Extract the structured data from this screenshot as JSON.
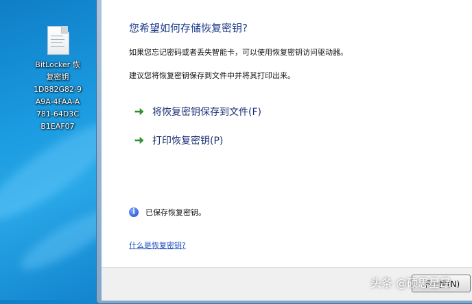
{
  "desktop": {
    "file_label_lines": [
      "BitLocker 恢",
      "复密钥",
      "1D882G82-9",
      "A9A-4FAA-A",
      "781-64D3C",
      "B1EAF07"
    ]
  },
  "dialog": {
    "title": "您希望如何存储恢复密钥?",
    "paragraph1": "如果您忘记密码或者丢失智能卡，可以使用恢复密钥访问驱动器。",
    "paragraph2": "建议您将恢复密钥保存到文件中并将其打印出来。",
    "commands": [
      {
        "label": "将恢复密钥保存到文件(F)",
        "icon": "green-arrow-icon"
      },
      {
        "label": "打印恢复密钥(P)",
        "icon": "green-arrow-icon"
      }
    ],
    "info_text": "已保存恢复密钥。",
    "help_link": "什么是恢复密钥?",
    "next_button": "下一步(N)"
  },
  "watermark": "头条 @硕思星昂",
  "colors": {
    "title": "#1e3b8c",
    "command": "#1b2f73",
    "arrow": "#2f9e2f",
    "link": "#1f4fbf",
    "desktop": "#1a9ae0"
  }
}
